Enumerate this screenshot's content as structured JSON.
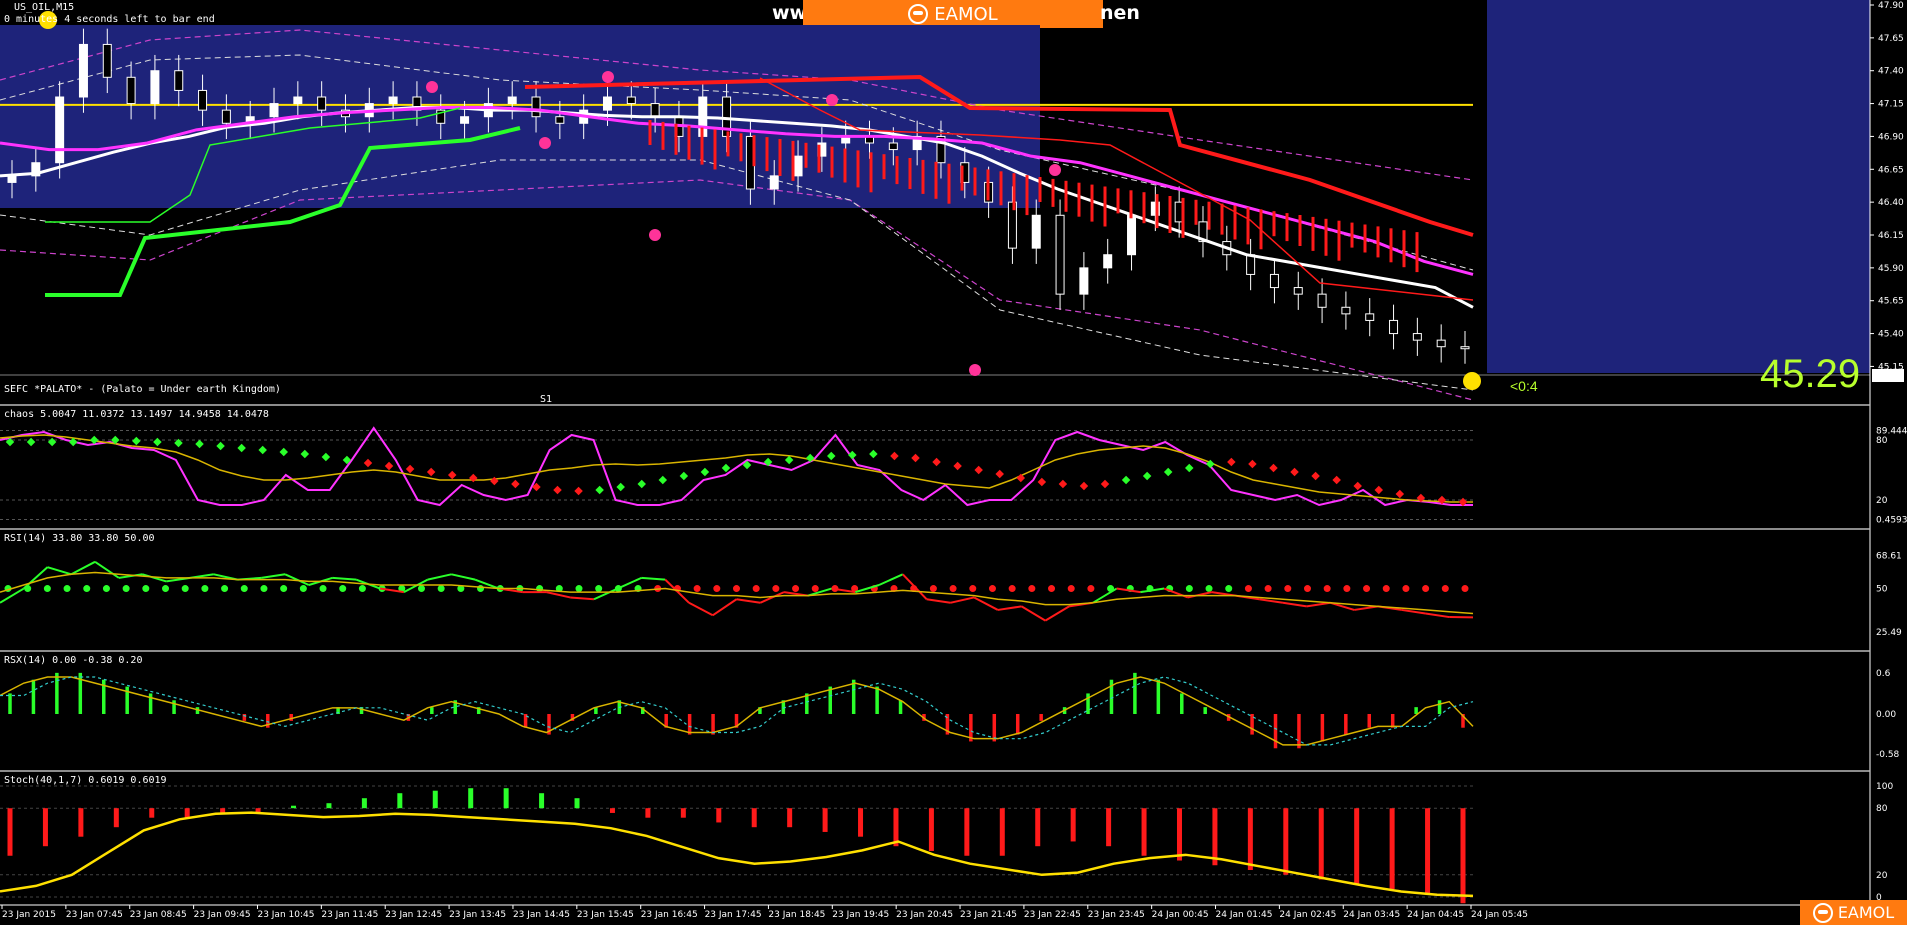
{
  "header": {
    "symbol": "US_OIL,M15",
    "countdown": "0 minutes 4 seconds left to bar end",
    "banner_left": "ww",
    "banner_brand": "EAMOL",
    "banner_right": "nen"
  },
  "indicator_label": "SEFC *PALATO* - (Palato = Under earth Kingdom)",
  "s1_label": "S1",
  "price": {
    "big": "45.29",
    "small": "<0:4",
    "tag": "45.29"
  },
  "watermark_brand": "EAMOL",
  "colors": {
    "background": "#000000",
    "blue_zone": "#1e237a",
    "bull": "#2aff2a",
    "bear": "#ff1a1a",
    "ema_white": "#ffffff",
    "ema_magenta": "#ff33ff",
    "signal_yellow": "#ffe000",
    "brand_orange": "#ff7a10"
  },
  "chart_data": [
    {
      "type": "candlestick",
      "name": "US_OIL,M15",
      "ylim": [
        45.1,
        47.9
      ],
      "yticks": [
        "47.90",
        "47.65",
        "47.40",
        "47.15",
        "46.90",
        "46.65",
        "46.40",
        "46.15",
        "45.90",
        "45.65",
        "45.40",
        "45.15"
      ],
      "horizontal_line": 47.14,
      "close_series": [
        46.6,
        46.7,
        47.2,
        47.6,
        47.35,
        47.15,
        47.4,
        47.25,
        47.1,
        47.0,
        47.05,
        47.15,
        47.2,
        47.1,
        47.05,
        47.15,
        47.2,
        47.1,
        47.0,
        47.05,
        47.15,
        47.2,
        47.05,
        47.0,
        47.1,
        47.2,
        47.15,
        47.05,
        46.9,
        47.2,
        46.9,
        46.5,
        46.6,
        46.75,
        46.85,
        46.9,
        46.85,
        46.8,
        46.9,
        46.7,
        46.55,
        46.4,
        46.05,
        46.3,
        45.7,
        45.9,
        46.0,
        46.3,
        46.4,
        46.25,
        46.1,
        46.0,
        45.85,
        45.75,
        45.7,
        45.6,
        45.55,
        45.5,
        45.4,
        45.35,
        45.3,
        45.29
      ],
      "ema_white": [
        46.6,
        46.62,
        46.7,
        46.78,
        46.85,
        46.9,
        46.97,
        47.0,
        47.05,
        47.08,
        47.1,
        47.12,
        47.12,
        47.1,
        47.1,
        47.08,
        47.06,
        47.05,
        47.05,
        47.04,
        47.02,
        47.0,
        46.98,
        46.95,
        46.9,
        46.85,
        46.75,
        46.62,
        46.5,
        46.4,
        46.3,
        46.2,
        46.1,
        46.0,
        45.95,
        45.9,
        45.85,
        45.8,
        45.75,
        45.6
      ],
      "ema_magenta": [
        46.85,
        46.8,
        46.8,
        46.85,
        46.95,
        47.0,
        47.05,
        47.08,
        47.1,
        47.12,
        47.12,
        47.1,
        47.05,
        47.0,
        46.98,
        46.95,
        46.92,
        46.9,
        46.9,
        46.88,
        46.85,
        46.75,
        46.7,
        46.6,
        46.5,
        46.4,
        46.3,
        46.2,
        46.1,
        45.95,
        45.85
      ],
      "time_labels": [
        "23 Jan 2015",
        "23 Jan 07:45",
        "23 Jan 08:45",
        "23 Jan 09:45",
        "23 Jan 10:45",
        "23 Jan 11:45",
        "23 Jan 12:45",
        "23 Jan 13:45",
        "23 Jan 14:45",
        "23 Jan 15:45",
        "23 Jan 16:45",
        "23 Jan 17:45",
        "23 Jan 18:45",
        "23 Jan 19:45",
        "23 Jan 20:45",
        "23 Jan 21:45",
        "23 Jan 22:45",
        "23 Jan 23:45",
        "24 Jan 00:45",
        "24 Jan 01:45",
        "24 Jan 02:45",
        "24 Jan 03:45",
        "24 Jan 04:45",
        "24 Jan 05:45"
      ]
    },
    {
      "type": "line",
      "label": "chaos 5.0047 11.0372 13.1497 14.9458 14.0478",
      "yticks": [
        "89.4444",
        "80",
        "20",
        "0.4593"
      ],
      "ylim": [
        0,
        100
      ],
      "series_magenta": [
        80,
        85,
        88,
        80,
        75,
        78,
        72,
        70,
        60,
        20,
        15,
        15,
        20,
        45,
        30,
        30,
        60,
        92,
        60,
        20,
        15,
        35,
        25,
        20,
        25,
        70,
        85,
        80,
        20,
        15,
        15,
        20,
        40,
        45,
        60,
        55,
        50,
        60,
        85,
        55,
        50,
        30,
        20,
        35,
        15,
        20,
        20,
        40,
        80,
        88,
        80,
        75,
        70,
        78,
        65,
        55,
        30,
        25,
        20,
        25,
        15,
        20,
        30,
        15,
        20,
        18,
        15,
        15
      ],
      "series_yellow": [
        82,
        84,
        85,
        83,
        80,
        77,
        74,
        72,
        68,
        60,
        50,
        44,
        40,
        40,
        42,
        45,
        48,
        50,
        48,
        44,
        40,
        40,
        40,
        42,
        46,
        50,
        52,
        55,
        56,
        55,
        56,
        58,
        60,
        62,
        65,
        66,
        64,
        60,
        56,
        52,
        48,
        44,
        40,
        36,
        34,
        32,
        40,
        50,
        60,
        66,
        70,
        72,
        74,
        72,
        66,
        58,
        48,
        40,
        36,
        32,
        28,
        26,
        24,
        22,
        20,
        19,
        18,
        18
      ],
      "dots": [
        78,
        78,
        78,
        78,
        80,
        80,
        79,
        78,
        77,
        76,
        74,
        72,
        70,
        68,
        66,
        63,
        60,
        57,
        54,
        51,
        48,
        45,
        42,
        39,
        36,
        33,
        30,
        29,
        30,
        33,
        36,
        40,
        44,
        48,
        52,
        55,
        58,
        60,
        62,
        64,
        65,
        66,
        64,
        62,
        58,
        54,
        50,
        46,
        42,
        38,
        36,
        34,
        36,
        40,
        44,
        48,
        52,
        56,
        58,
        56,
        52,
        48,
        44,
        40,
        34,
        30,
        26,
        22,
        20,
        18
      ]
    },
    {
      "type": "line",
      "label": "RSI(14) 33.80 33.80 50.00",
      "yticks": [
        "68.61",
        "50",
        "25.49"
      ],
      "ylim": [
        20,
        75
      ],
      "series_rsi": [
        42,
        50,
        62,
        58,
        65,
        56,
        58,
        54,
        56,
        58,
        55,
        56,
        58,
        52,
        56,
        55,
        50,
        48,
        55,
        58,
        55,
        50,
        48,
        48,
        45,
        44,
        50,
        56,
        55,
        42,
        35,
        44,
        42,
        48,
        46,
        50,
        48,
        52,
        58,
        44,
        42,
        45,
        38,
        40,
        32,
        40,
        42,
        50,
        48,
        50,
        45,
        48,
        46,
        44,
        42,
        40,
        42,
        38,
        40,
        38,
        36,
        34,
        33.8
      ],
      "series_signal": [
        48,
        52,
        56,
        58,
        59,
        58,
        57,
        56,
        56,
        56,
        55,
        55,
        55,
        54,
        54,
        53,
        52,
        52,
        52,
        52,
        51,
        50,
        50,
        49,
        48,
        48,
        48,
        49,
        50,
        48,
        46,
        46,
        45,
        46,
        46,
        47,
        47,
        48,
        49,
        48,
        47,
        46,
        44,
        43,
        41,
        41,
        42,
        44,
        45,
        46,
        46,
        46,
        46,
        45,
        44,
        43,
        42,
        41,
        40,
        39,
        38,
        37,
        36
      ],
      "level": 50
    },
    {
      "type": "bar",
      "label": "RSX(14) 0.00 -0.38 0.20",
      "yticks": [
        "0.6",
        "0.00",
        "-0.58"
      ],
      "ylim": [
        -0.7,
        0.7
      ],
      "values": [
        0.3,
        0.5,
        0.6,
        0.6,
        0.5,
        0.4,
        0.3,
        0.2,
        0.1,
        0.0,
        -0.1,
        -0.2,
        -0.1,
        0.0,
        0.1,
        0.1,
        0.0,
        -0.1,
        0.1,
        0.2,
        0.1,
        0.0,
        -0.2,
        -0.3,
        -0.1,
        0.1,
        0.2,
        0.1,
        -0.2,
        -0.3,
        -0.3,
        -0.2,
        0.1,
        0.2,
        0.3,
        0.4,
        0.5,
        0.4,
        0.2,
        -0.1,
        -0.3,
        -0.4,
        -0.4,
        -0.3,
        -0.1,
        0.1,
        0.3,
        0.5,
        0.6,
        0.5,
        0.3,
        0.1,
        -0.1,
        -0.3,
        -0.5,
        -0.5,
        -0.4,
        -0.3,
        -0.2,
        -0.2,
        0.1,
        0.2,
        -0.2
      ]
    },
    {
      "type": "bar",
      "label": "Stoch(40,1,7) 0.6019 0.6019",
      "yticks": [
        "100",
        "80",
        "20",
        "0"
      ],
      "ylim": [
        0,
        100
      ],
      "values": [
        -0.5,
        -0.4,
        -0.3,
        -0.2,
        -0.1,
        -0.1,
        -0.05,
        -0.05,
        0.05,
        0.1,
        0.2,
        0.3,
        0.35,
        0.4,
        0.4,
        0.3,
        0.2,
        -0.05,
        -0.1,
        -0.1,
        -0.15,
        -0.2,
        -0.2,
        -0.25,
        -0.3,
        -0.4,
        -0.45,
        -0.5,
        -0.5,
        -0.4,
        -0.35,
        -0.4,
        -0.5,
        -0.55,
        -0.6,
        -0.65,
        -0.7,
        -0.75,
        -0.8,
        -0.85,
        -0.9,
        -1.0
      ],
      "signal": [
        5,
        10,
        20,
        40,
        60,
        70,
        75,
        76,
        74,
        72,
        73,
        75,
        74,
        72,
        70,
        68,
        66,
        62,
        55,
        45,
        35,
        30,
        32,
        36,
        42,
        50,
        38,
        30,
        25,
        20,
        22,
        30,
        35,
        38,
        34,
        28,
        22,
        16,
        10,
        5,
        2,
        1
      ]
    }
  ]
}
